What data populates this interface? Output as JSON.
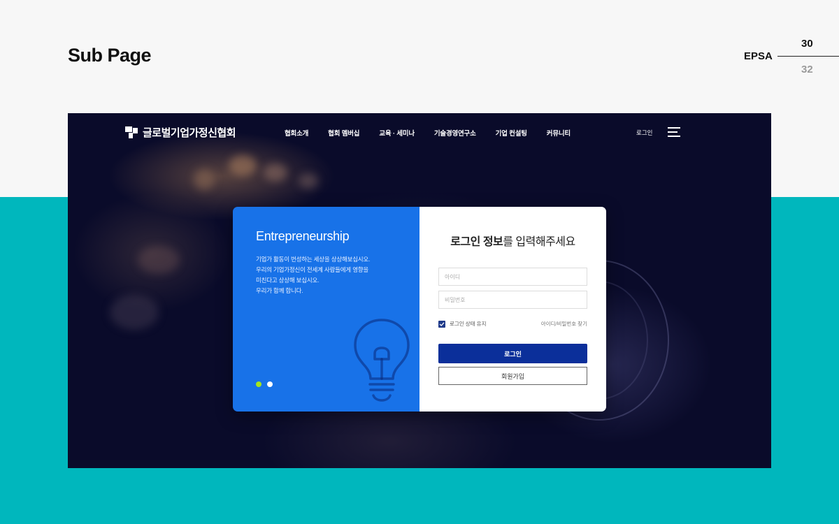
{
  "slide": {
    "title": "Sub Page",
    "brand": "EPSA",
    "current_page": "30",
    "total_pages": "32"
  },
  "colors": {
    "page_bg": "#f7f7f7",
    "teal_band": "#00b7bd",
    "hero_bg": "#0a0b2a",
    "card_blue": "#1872e8",
    "login_button": "#0b2f9a",
    "active_dot": "#a4e51c"
  },
  "site": {
    "logo_text": "글로벌기업가정신협회",
    "logo_icon": "logo-mark-icon",
    "menu": [
      "협회소개",
      "협회 멤버십",
      "교육 · 세미나",
      "기술경영연구소",
      "기업 컨설팅",
      "커뮤니티"
    ],
    "login_link": "로그인",
    "menu_icon": "hamburger-icon"
  },
  "login_card": {
    "left": {
      "heading": "Entrepreneurship",
      "description": [
        "기업가 활동이 번성하는 세상을 상상해보십시오.",
        "우리의 기업가정신이 전세계 사람들에게 영향을",
        "미친다고 상상해 보십시오.",
        "우리가 함께 합니다."
      ],
      "illustration": "lightbulb-icon",
      "carousel_active": 0
    },
    "right": {
      "title_bold": "로그인 정보",
      "title_rest": "를 입력해주세요",
      "id_placeholder": "아이디",
      "password_placeholder": "비밀번호",
      "remember_label": "로그인 상태 유지",
      "remember_checked": true,
      "find_link": "아이디/비밀번호 찾기",
      "login_button": "로그인",
      "join_button": "회원가입"
    }
  }
}
